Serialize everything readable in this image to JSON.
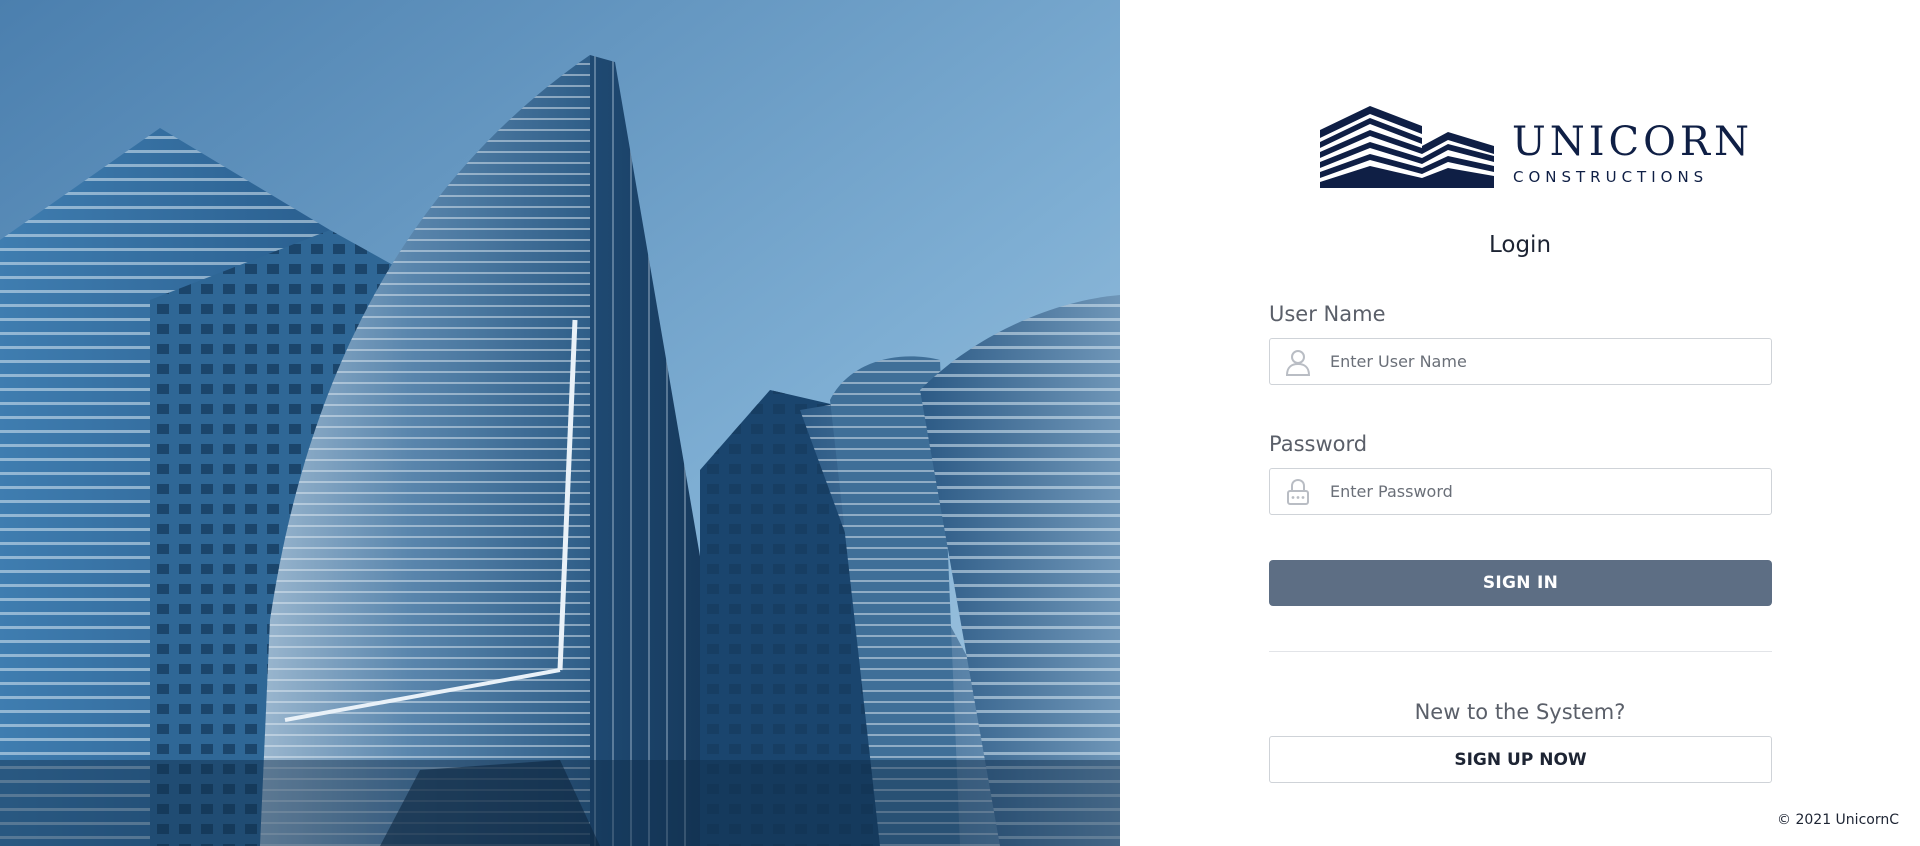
{
  "hero": {
    "image_name": "skyscrapers-photo",
    "colors": {
      "sky": "#6d9fc8",
      "glass": "#1d4f7d",
      "glass_light": "#4b86b6"
    }
  },
  "logo": {
    "word": "UNICORN",
    "sub": "CONSTRUCTIONS",
    "color": "#0f1f45"
  },
  "login": {
    "title": "Login",
    "username": {
      "label": "User Name",
      "placeholder": "Enter User Name",
      "icon": "user-icon"
    },
    "password": {
      "label": "Password",
      "placeholder": "Enter Password",
      "icon": "lock-icon"
    },
    "signin_label": "SIGN IN",
    "signin_color": "#5d6e84"
  },
  "signup": {
    "prompt": "New to the System?",
    "button_label": "SIGN UP NOW"
  },
  "footer": {
    "copyright": "© 2021 UnicornC"
  }
}
